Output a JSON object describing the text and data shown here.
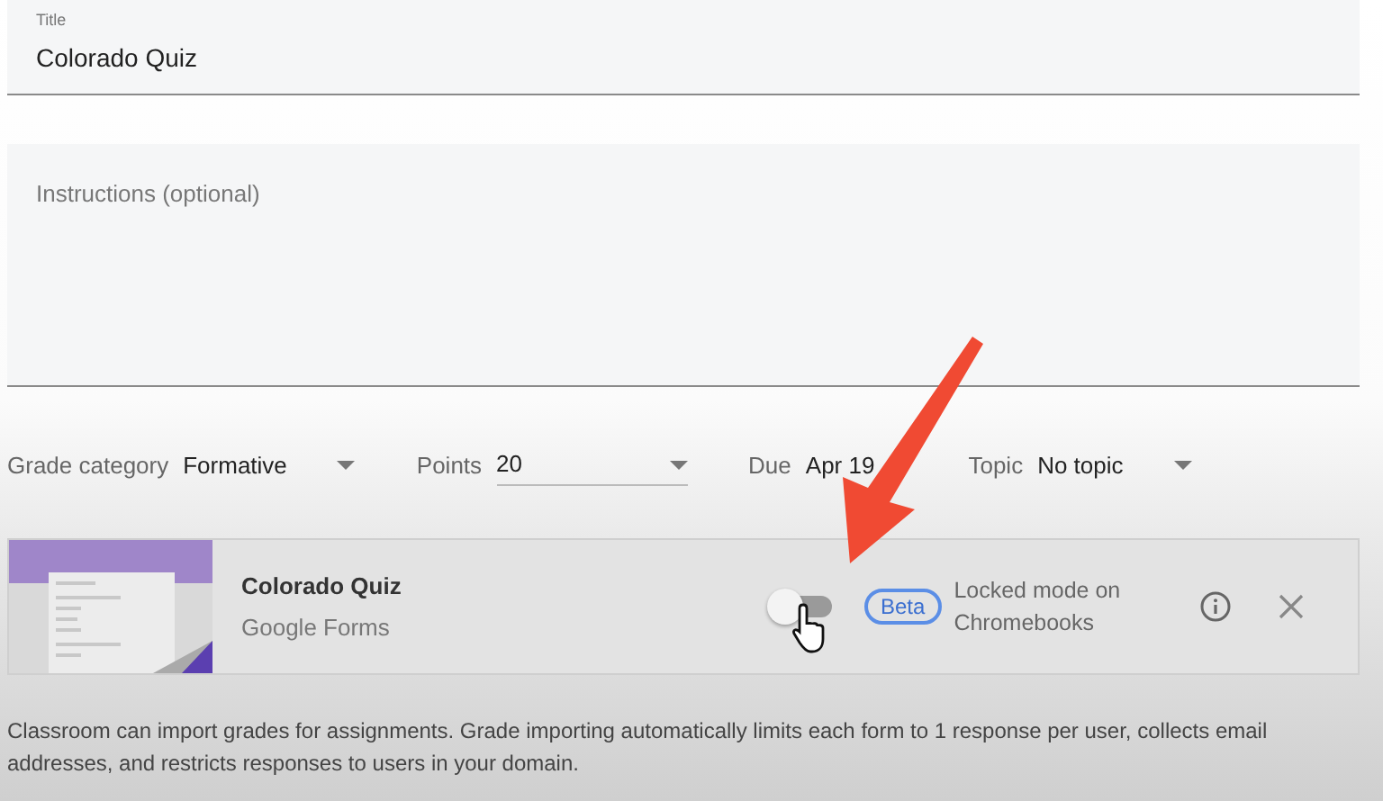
{
  "title_field": {
    "label": "Title",
    "value": "Colorado Quiz"
  },
  "instructions_field": {
    "placeholder": "Instructions (optional)"
  },
  "settings": [
    {
      "kind": "dropdown",
      "label": "Grade category",
      "value": "Formative"
    },
    {
      "kind": "input",
      "label": "Points",
      "value": "20"
    },
    {
      "kind": "date",
      "label": "Due",
      "value": "Apr 19"
    },
    {
      "kind": "dropdown",
      "label": "Topic",
      "value": "No topic"
    }
  ],
  "attachment": {
    "title": "Colorado Quiz",
    "subtitle": "Google Forms",
    "locked_mode": {
      "on": false,
      "badge": "Beta",
      "label": "Locked mode on Chromebooks"
    }
  },
  "note": "Classroom can import grades for assignments. Grade importing automatically limits each form to 1 response per user, collects email addresses, and restricts responses to users in your domain."
}
